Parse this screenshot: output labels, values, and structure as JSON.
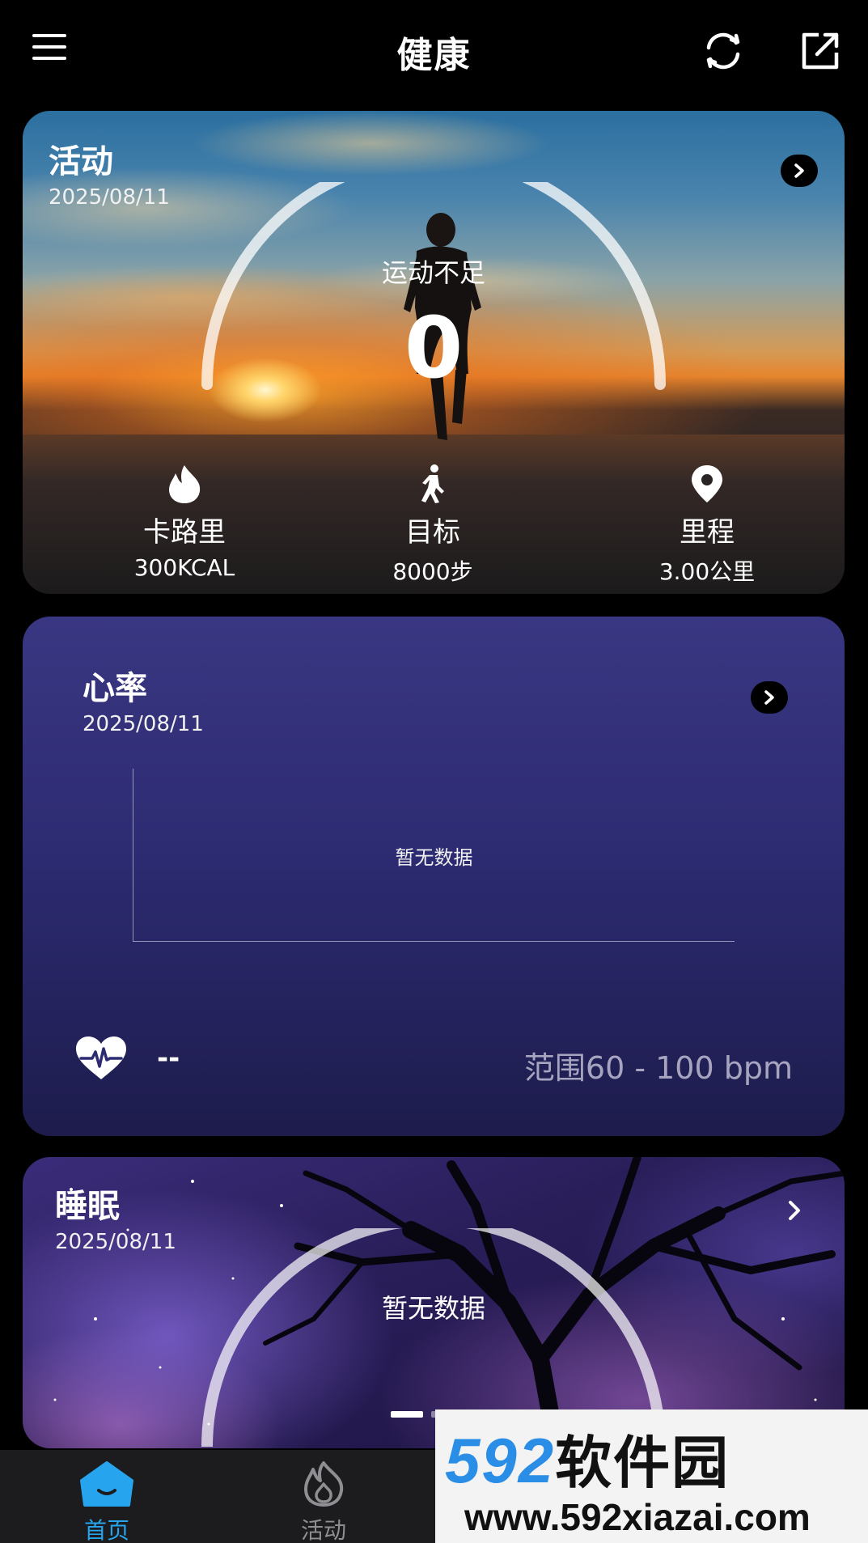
{
  "header": {
    "title": "健康",
    "left_icon": "menu-icon",
    "right_icons": [
      "sync-icon",
      "share-icon"
    ]
  },
  "activity": {
    "title": "活动",
    "date": "2025/08/11",
    "status": "运动不足",
    "value": "0",
    "stats": [
      {
        "icon": "flame-icon",
        "label": "卡路里",
        "value": "300KCAL"
      },
      {
        "icon": "walking-icon",
        "label": "目标",
        "value": "8000步"
      },
      {
        "icon": "location-pin-icon",
        "label": "里程",
        "value": "3.00公里"
      }
    ]
  },
  "heart_rate": {
    "title": "心率",
    "date": "2025/08/11",
    "empty_text": "暂无数据",
    "current": "--",
    "range": "范围60 - 100 bpm"
  },
  "sleep": {
    "title": "睡眠",
    "date": "2025/08/11",
    "empty_text": "暂无数据"
  },
  "bottom_nav": {
    "items": [
      {
        "label": "首页",
        "icon": "home-icon",
        "active": true
      },
      {
        "label": "活动",
        "icon": "flame-outline-icon",
        "active": false
      }
    ]
  },
  "watermark": {
    "logo_digits": "592",
    "logo_cn": "软件园",
    "url": "www.592xiazai.com"
  },
  "colors": {
    "accent": "#27a4ee",
    "heart_card": "#2d2b72",
    "inactive": "#8e8e93"
  }
}
